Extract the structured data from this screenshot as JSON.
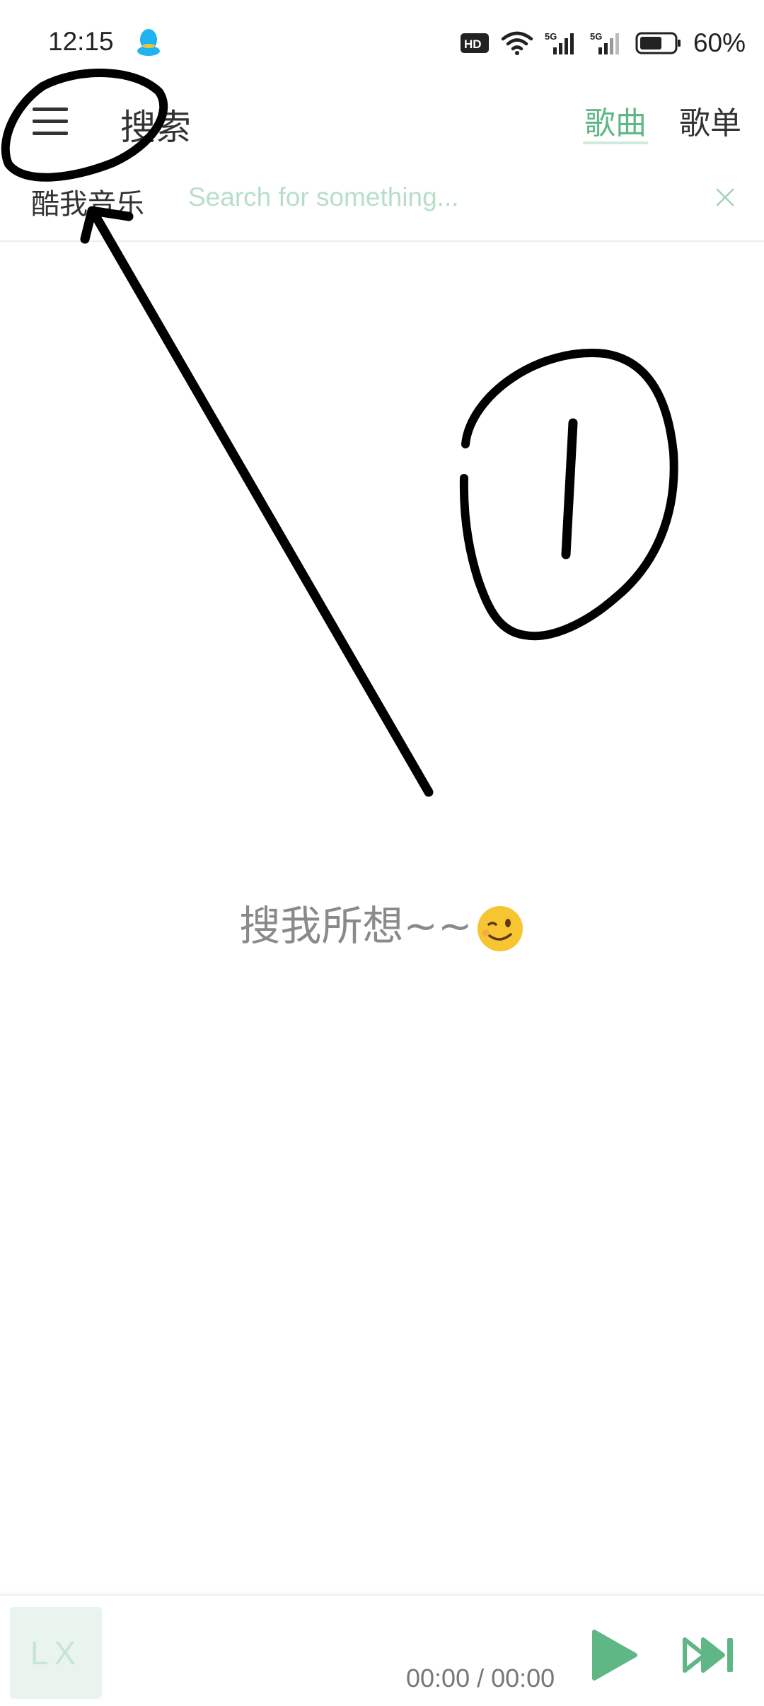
{
  "status_bar": {
    "time": "12:15",
    "battery_percent": "60%",
    "network_labels": [
      "HD",
      "5G",
      "5G"
    ]
  },
  "header": {
    "title": "搜索",
    "tabs": [
      {
        "label": "歌曲",
        "active": true
      },
      {
        "label": "歌单",
        "active": false
      }
    ],
    "source_label": "酷我音乐",
    "search_placeholder": "Search for something...",
    "search_value": ""
  },
  "main": {
    "empty_message": "搜我所想~~"
  },
  "player": {
    "cover_text": "LX",
    "time": "00:00 / 00:00"
  },
  "colors": {
    "accent": "#5fb785",
    "accent_light": "#cfeadb",
    "annotation": "#000000"
  },
  "icons": [
    "qq-icon",
    "hd-icon",
    "wifi-icon",
    "signal-5g-icon",
    "battery-icon",
    "menu-icon",
    "clear-icon",
    "wink-emoji-icon",
    "play-icon",
    "next-icon"
  ]
}
